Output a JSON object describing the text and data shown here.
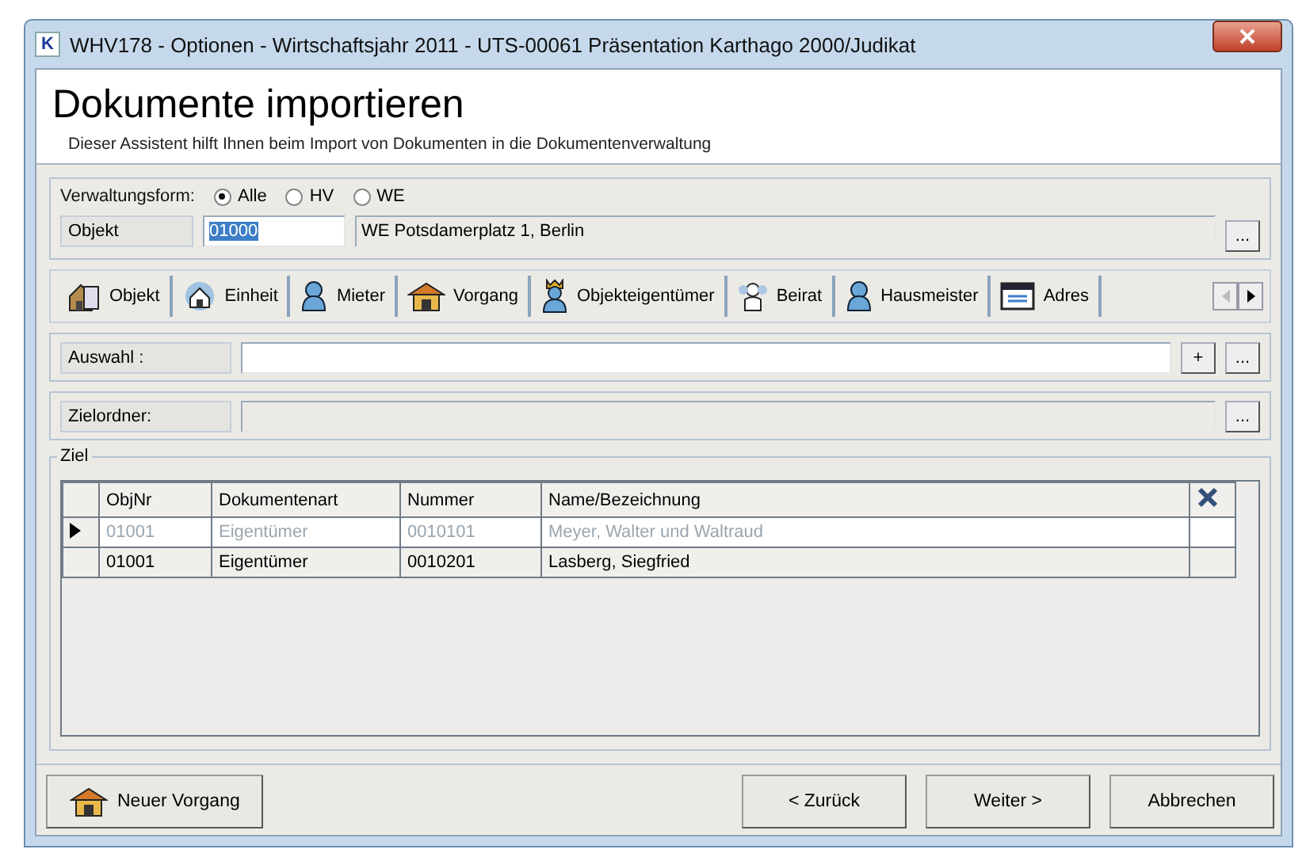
{
  "window": {
    "app_letter": "K",
    "title": "WHV178 - Optionen - Wirtschaftsjahr 2011 - UTS-00061 Präsentation Karthago 2000/Judikat"
  },
  "header": {
    "title": "Dokumente importieren",
    "subtitle": "Dieser Assistent hilft Ihnen beim Import von Dokumenten in die Dokumentenverwaltung"
  },
  "verwaltungsform": {
    "label": "Verwaltungsform:",
    "options": [
      {
        "label": "Alle",
        "selected": true
      },
      {
        "label": "HV",
        "selected": false
      },
      {
        "label": "WE",
        "selected": false
      }
    ]
  },
  "objekt": {
    "label": "Objekt",
    "value": "01000",
    "description": "WE Potsdamerplatz 1, Berlin",
    "button": "..."
  },
  "tabs": [
    {
      "label": "Objekt",
      "kind": "house"
    },
    {
      "label": "Einheit",
      "kind": "unit"
    },
    {
      "label": "Mieter",
      "kind": "person"
    },
    {
      "label": "Vorgang",
      "kind": "roof"
    },
    {
      "label": "Objekteigentümer",
      "kind": "crown"
    },
    {
      "label": "Beirat",
      "kind": "board"
    },
    {
      "label": "Hausmeister",
      "kind": "person"
    },
    {
      "label": "Adres",
      "kind": "list"
    }
  ],
  "auswahl": {
    "label": "Auswahl :",
    "add_button": "+",
    "button": "..."
  },
  "zielordner": {
    "label": "Zielordner:",
    "button": "..."
  },
  "ziel": {
    "legend": "Ziel",
    "columns": [
      "ObjNr",
      "Dokumentenart",
      "Nummer",
      "Name/Bezeichnung"
    ],
    "rows": [
      {
        "selected": true,
        "cells": [
          "01001",
          "Eigentümer",
          "0010101",
          "Meyer, Walter und Waltraud"
        ]
      },
      {
        "selected": false,
        "cells": [
          "01001",
          "Eigentümer",
          "0010201",
          "Lasberg, Siegfried"
        ]
      }
    ]
  },
  "footer": {
    "new_button": "Neuer Vorgang",
    "buttons": [
      "< Zurück",
      "Weiter >",
      "Abbrechen"
    ]
  }
}
